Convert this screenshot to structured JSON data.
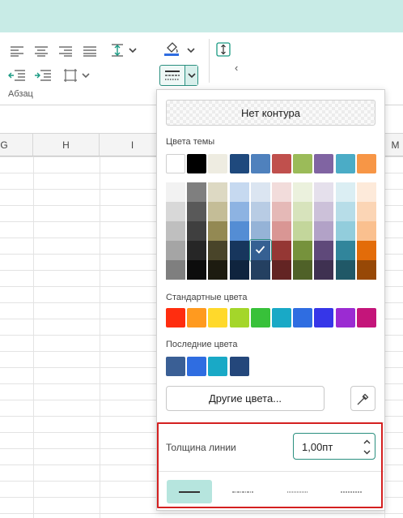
{
  "ribbon": {
    "paragraph_group_label": "Абзац",
    "collapse_glyph": "‹"
  },
  "sheet": {
    "columns": [
      "G",
      "H",
      "I",
      "M"
    ]
  },
  "border_menu": {
    "no_border_label": "Нет контура",
    "theme_colors_label": "Цвета темы",
    "standard_colors_label": "Стандартные цвета",
    "recent_colors_label": "Последние цвета",
    "more_colors_label": "Другие цвета...",
    "line_width_label": "Толщина линии",
    "line_width_value": "1,00пт",
    "theme_colors_top": [
      "#ffffff",
      "#000000",
      "#eeece1",
      "#1f497d",
      "#4f81bd",
      "#c0504d",
      "#9bbb59",
      "#8064a2",
      "#4bacc6",
      "#f79646"
    ],
    "theme_shades": [
      [
        "#f2f2f2",
        "#d8d8d8",
        "#bfbfbf",
        "#a5a5a5",
        "#7f7f7f"
      ],
      [
        "#7f7f7f",
        "#595959",
        "#3f3f3f",
        "#262626",
        "#0c0c0c"
      ],
      [
        "#ddd9c3",
        "#c4bd97",
        "#938953",
        "#494429",
        "#1d1b10"
      ],
      [
        "#c6d9f0",
        "#8db3e2",
        "#548dd4",
        "#17365d",
        "#0f243e"
      ],
      [
        "#dbe5f1",
        "#b8cce4",
        "#95b3d7",
        "#366092",
        "#244061"
      ],
      [
        "#f2dcdb",
        "#e5b9b7",
        "#d99694",
        "#953734",
        "#632423"
      ],
      [
        "#ebf1dd",
        "#d7e3bc",
        "#c3d69b",
        "#76923c",
        "#4f6128"
      ],
      [
        "#e5e0ec",
        "#ccc1d9",
        "#b2a2c7",
        "#5f497a",
        "#3f3151"
      ],
      [
        "#dbeef3",
        "#b7dde8",
        "#92cddc",
        "#31859b",
        "#205867"
      ],
      [
        "#fdeada",
        "#fbd5b5",
        "#fac08f",
        "#e36c09",
        "#974806"
      ]
    ],
    "selected_color": "#366092",
    "standard_colors": [
      "#ff2d0f",
      "#ff9a1f",
      "#ffd92b",
      "#a4d62a",
      "#38c13a",
      "#19a9c6",
      "#2f6de1",
      "#3636e8",
      "#9b2bd2",
      "#c4157a"
    ],
    "recent_colors": [
      "#3a5f95",
      "#2f6de1",
      "#19a9c6",
      "#24477b"
    ],
    "icons": [
      "eyedropper-icon",
      "chevron-up-icon",
      "chevron-down-icon",
      "checkmark-icon"
    ]
  }
}
